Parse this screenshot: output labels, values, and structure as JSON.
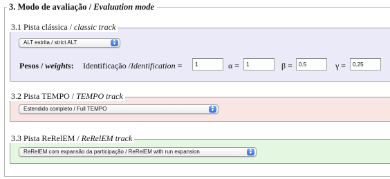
{
  "section": {
    "number_label": "3. Modo de avaliação / ",
    "title_en": "Evaluation mode"
  },
  "classic": {
    "legend_pt": "3.1 Pista clássica / ",
    "legend_en": "classic track",
    "select_value": "ALT estrita / strict ALT",
    "weights_label_pt": "Pesos / ",
    "weights_label_en": "weights",
    "weights_colon": ":",
    "identification_label_pt": "Identificação /",
    "identification_label_en": "Identification",
    "equals": " =",
    "identification_value": "1",
    "alpha_label": "α =",
    "alpha_value": "1",
    "beta_label": "β =",
    "beta_value": "0.5",
    "gamma_label": "γ =",
    "gamma_value": "0.25"
  },
  "tempo": {
    "legend_pt": "3.2 Pista TEMPO / ",
    "legend_en": "TEMPO track",
    "select_value": "Estendido completo / Full TEMPO"
  },
  "rerelem": {
    "legend_pt": "3.3 Pista ReRelEM / ",
    "legend_en": "ReRelEM track",
    "select_value": "ReRelEM com expansão da participação / ReRelEM with run expansion"
  },
  "icons": {
    "select_arrows": "up-down-arrows-icon"
  }
}
